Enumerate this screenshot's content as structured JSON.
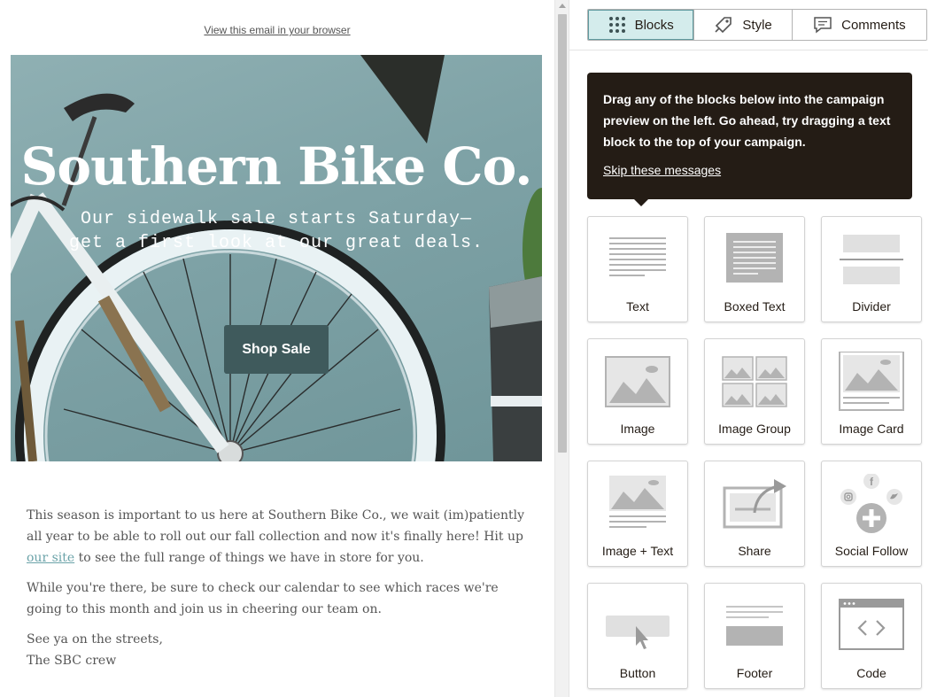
{
  "email": {
    "browser_link": "View this email in your browser",
    "hero": {
      "title": "Southern Bike Co.",
      "subtitle_line1": "Our sidewalk sale starts Saturday—",
      "subtitle_line2": "get a first look at our great deals.",
      "button_label": "Shop Sale"
    },
    "body": {
      "p1_before_link": "This season is important to us here at Southern Bike Co., we wait (im)patiently all year to be able to roll out our fall collection and now it's finally here! Hit up ",
      "p1_link": "our site",
      "p1_after_link": " to see the full range of things we have in store for you.",
      "p2": "While you're there, be sure to check our calendar to see which races we're going to this month and join us in cheering our team on.",
      "signoff_line1": "See ya on the streets,",
      "signoff_line2": "The SBC crew"
    },
    "colors": {
      "button": "#3f5a5c",
      "link": "#6ba3a9",
      "hero_bg": "#7ea2a6"
    }
  },
  "panel": {
    "tabs": [
      {
        "label": "Blocks",
        "icon": "grid-dots-icon",
        "active": true
      },
      {
        "label": "Style",
        "icon": "paint-tag-icon",
        "active": false
      },
      {
        "label": "Comments",
        "icon": "comment-icon",
        "active": false
      }
    ],
    "tooltip": {
      "text": "Drag any of the blocks below into the campaign preview on the left. Go ahead, try dragging a text block to the top of your campaign.",
      "skip_label": "Skip these messages"
    },
    "blocks": [
      {
        "label": "Text",
        "icon": "text-block-icon"
      },
      {
        "label": "Boxed Text",
        "icon": "boxed-text-icon"
      },
      {
        "label": "Divider",
        "icon": "divider-icon"
      },
      {
        "label": "Image",
        "icon": "image-icon"
      },
      {
        "label": "Image Group",
        "icon": "image-group-icon"
      },
      {
        "label": "Image Card",
        "icon": "image-card-icon"
      },
      {
        "label": "Image + Text",
        "icon": "image-text-icon"
      },
      {
        "label": "Share",
        "icon": "share-icon"
      },
      {
        "label": "Social Follow",
        "icon": "social-follow-icon"
      },
      {
        "label": "Button",
        "icon": "button-icon"
      },
      {
        "label": "Footer",
        "icon": "footer-icon"
      },
      {
        "label": "Code",
        "icon": "code-icon"
      }
    ],
    "colors": {
      "active_tab_bg": "#d4ecec",
      "tooltip_bg": "#241c15"
    }
  }
}
